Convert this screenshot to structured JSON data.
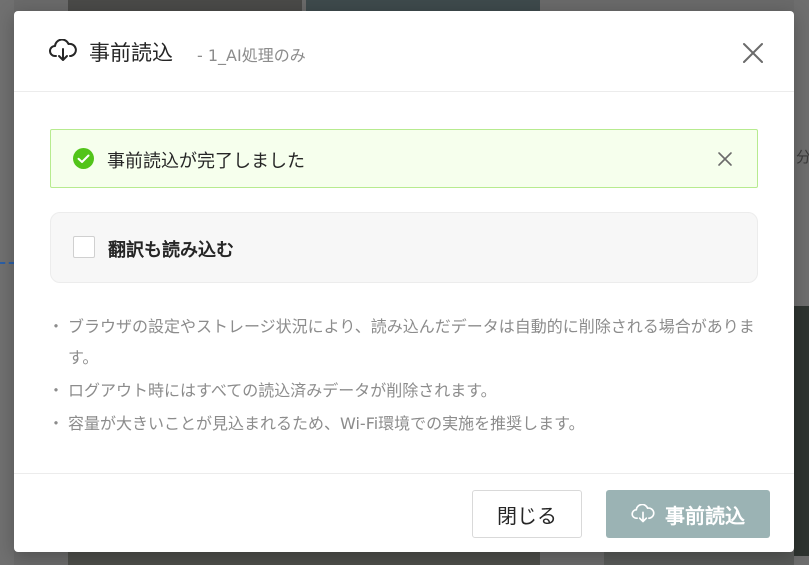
{
  "modal": {
    "title": "事前読込",
    "subtitle": "- 1_AI処理のみ",
    "header_icon": "cloud-download-icon",
    "close_icon": "close-icon"
  },
  "alert": {
    "text": "事前読込が完了しました",
    "icon": "check-circle-icon",
    "color": "#52c41a"
  },
  "option": {
    "label": "翻訳も読み込む",
    "checked": false
  },
  "notes": [
    "ブラウザの設定やストレージ状況により、読み込んだデータは自動的に削除される場合があります。",
    "ログアウト時にはすべての読込済みデータが削除されます。",
    "容量が大きいことが見込まれるため、Wi-Fi環境での実施を推奨します。"
  ],
  "footer": {
    "close_label": "閉じる",
    "primary_label": "事前読込",
    "primary_color": "#9bb3b4"
  },
  "background": {
    "side_text": "分"
  }
}
